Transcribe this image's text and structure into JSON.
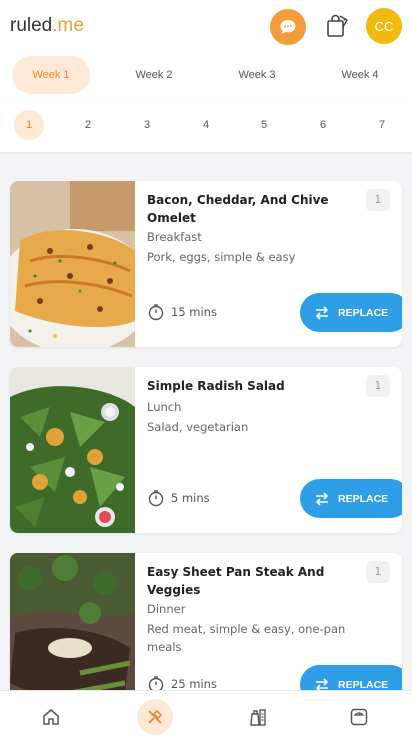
{
  "header": {
    "logo_main": "ruled",
    "logo_accent": ".me",
    "avatar_initials": "CC",
    "accent_color": "#f39c3a",
    "avatar_color": "#f2b90f",
    "chat_icon": "chat-bubble-icon",
    "bag_icon": "shopping-bag-icon"
  },
  "weeks": [
    "Week 1",
    "Week 2",
    "Week 3",
    "Week 4"
  ],
  "days": [
    "1",
    "2",
    "3",
    "4",
    "5",
    "6",
    "7"
  ],
  "meals": [
    {
      "title": "Bacon, Cheddar, And Chive Omelet",
      "meal": "Breakfast",
      "tags": "Pork, eggs, simple & easy",
      "time": "15 mins",
      "servings": "1",
      "replace_label": "REPLACE"
    },
    {
      "title": "Simple Radish Salad",
      "meal": "Lunch",
      "tags": "Salad, vegetarian",
      "time": "5 mins",
      "servings": "1",
      "replace_label": "REPLACE"
    },
    {
      "title": "Easy Sheet Pan Steak And Veggies",
      "meal": "Dinner",
      "tags": "Red meat, simple & easy, one-pan meals",
      "time": "25 mins",
      "servings": "1",
      "replace_label": "REPLACE"
    }
  ],
  "bottom_nav": [
    "home-icon",
    "utensils-icon",
    "shopping-list-icon",
    "scale-icon"
  ],
  "replace_color": "#2e9ee6"
}
